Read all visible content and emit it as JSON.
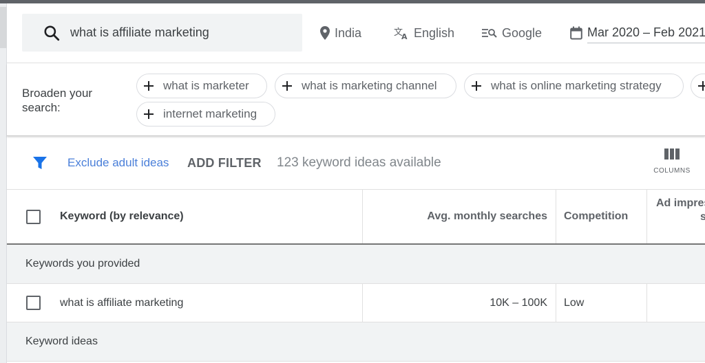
{
  "search": {
    "query": "what is affiliate marketing",
    "location": "India",
    "language": "English",
    "network": "Google",
    "date_range": "Mar 2020 – Feb 2021"
  },
  "broaden": {
    "label": "Broaden your search:",
    "chips": [
      {
        "label": "what is marketer"
      },
      {
        "label": "what is marketing channel"
      },
      {
        "label": "what is online marketing strategy"
      },
      {
        "label": ""
      },
      {
        "label": "internet marketing"
      }
    ]
  },
  "filter_bar": {
    "exclude_label": "Exclude adult ideas",
    "add_filter_label": "ADD FILTER",
    "ideas_count": "123 keyword ideas available",
    "columns_label": "COLUMNS"
  },
  "table": {
    "headers": {
      "keyword": "Keyword (by relevance)",
      "avg_monthly": "Avg. monthly searches",
      "competition": "Competition",
      "ad_impression_line1": "Ad impres",
      "ad_impression_line2": "s"
    },
    "groups": [
      {
        "label": "Keywords you provided",
        "rows": [
          {
            "keyword": "what is affiliate marketing",
            "avg_monthly": "10K – 100K",
            "competition": "Low",
            "ad_share": ""
          }
        ]
      },
      {
        "label": "Keyword ideas",
        "rows": []
      }
    ]
  },
  "colors": {
    "accent_blue": "#4a7fd9",
    "filter_icon": "#1a73e8",
    "text_primary": "#3c4043",
    "text_secondary": "#5f6368",
    "group_bg": "#f1f3f4"
  }
}
